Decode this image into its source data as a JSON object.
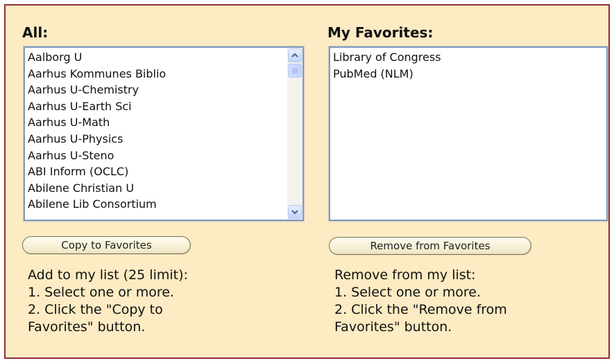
{
  "all": {
    "title": "All:",
    "items": [
      "Aalborg U",
      "Aarhus Kommunes Biblio",
      "Aarhus U-Chemistry",
      "Aarhus U-Earth Sci",
      "Aarhus U-Math",
      "Aarhus U-Physics",
      "Aarhus U-Steno",
      "ABI Inform (OCLC)",
      "Abilene Christian U",
      "Abilene Lib Consortium"
    ],
    "button_label": "Copy to Favorites",
    "instructions": [
      "Add to my list (25 limit):",
      "1. Select one or more.",
      "2. Click the \"Copy to",
      "Favorites\" button."
    ]
  },
  "favorites": {
    "title": "My Favorites:",
    "items": [
      "Library of Congress",
      "PubMed (NLM)"
    ],
    "button_label": "Remove from Favorites",
    "instructions": [
      "Remove from my list:",
      "1. Select one or more.",
      "2. Click the \"Remove from",
      "Favorites\" button."
    ]
  },
  "icons": {
    "scroll_up": "chevron-up-icon",
    "scroll_down": "chevron-down-icon"
  },
  "colors": {
    "panel_background": "#fcebc3",
    "panel_border": "#8c2e34",
    "listbox_border": "#7f9db9"
  }
}
